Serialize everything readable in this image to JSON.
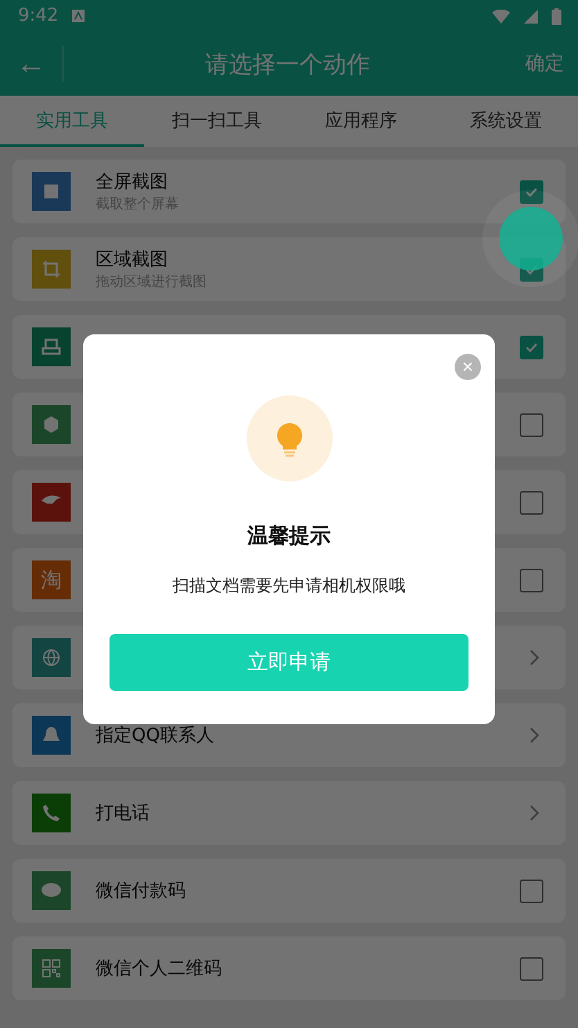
{
  "status_bar": {
    "time": "9:42"
  },
  "app_bar": {
    "back": "←",
    "title": "请选择一个动作",
    "action": "确定"
  },
  "tabs": [
    {
      "label": "实用工具",
      "selected": true
    },
    {
      "label": "扫一扫工具",
      "selected": false
    },
    {
      "label": "应用程序",
      "selected": false
    },
    {
      "label": "系统设置",
      "selected": false
    }
  ],
  "items": [
    {
      "title": "全屏截图",
      "subtitle": "截取整个屏幕",
      "kind": "check",
      "checked": true
    },
    {
      "title": "区域截图",
      "subtitle": "拖动区域进行截图",
      "kind": "check",
      "checked": true
    },
    {
      "kind": "check",
      "checked": true
    },
    {
      "kind": "check",
      "checked": false
    },
    {
      "kind": "check",
      "checked": false
    },
    {
      "icon_text": "淘",
      "kind": "check",
      "checked": false
    },
    {
      "kind": "link"
    },
    {
      "title": "指定QQ联系人",
      "kind": "link"
    },
    {
      "title": "打电话",
      "kind": "link"
    },
    {
      "title": "微信付款码",
      "kind": "check",
      "checked": false
    },
    {
      "title": "微信个人二维码",
      "kind": "check",
      "checked": false
    }
  ],
  "dialog": {
    "close": "×",
    "title": "温馨提示",
    "message": "扫描文档需要先申请相机权限哦",
    "button": "立即申请"
  }
}
